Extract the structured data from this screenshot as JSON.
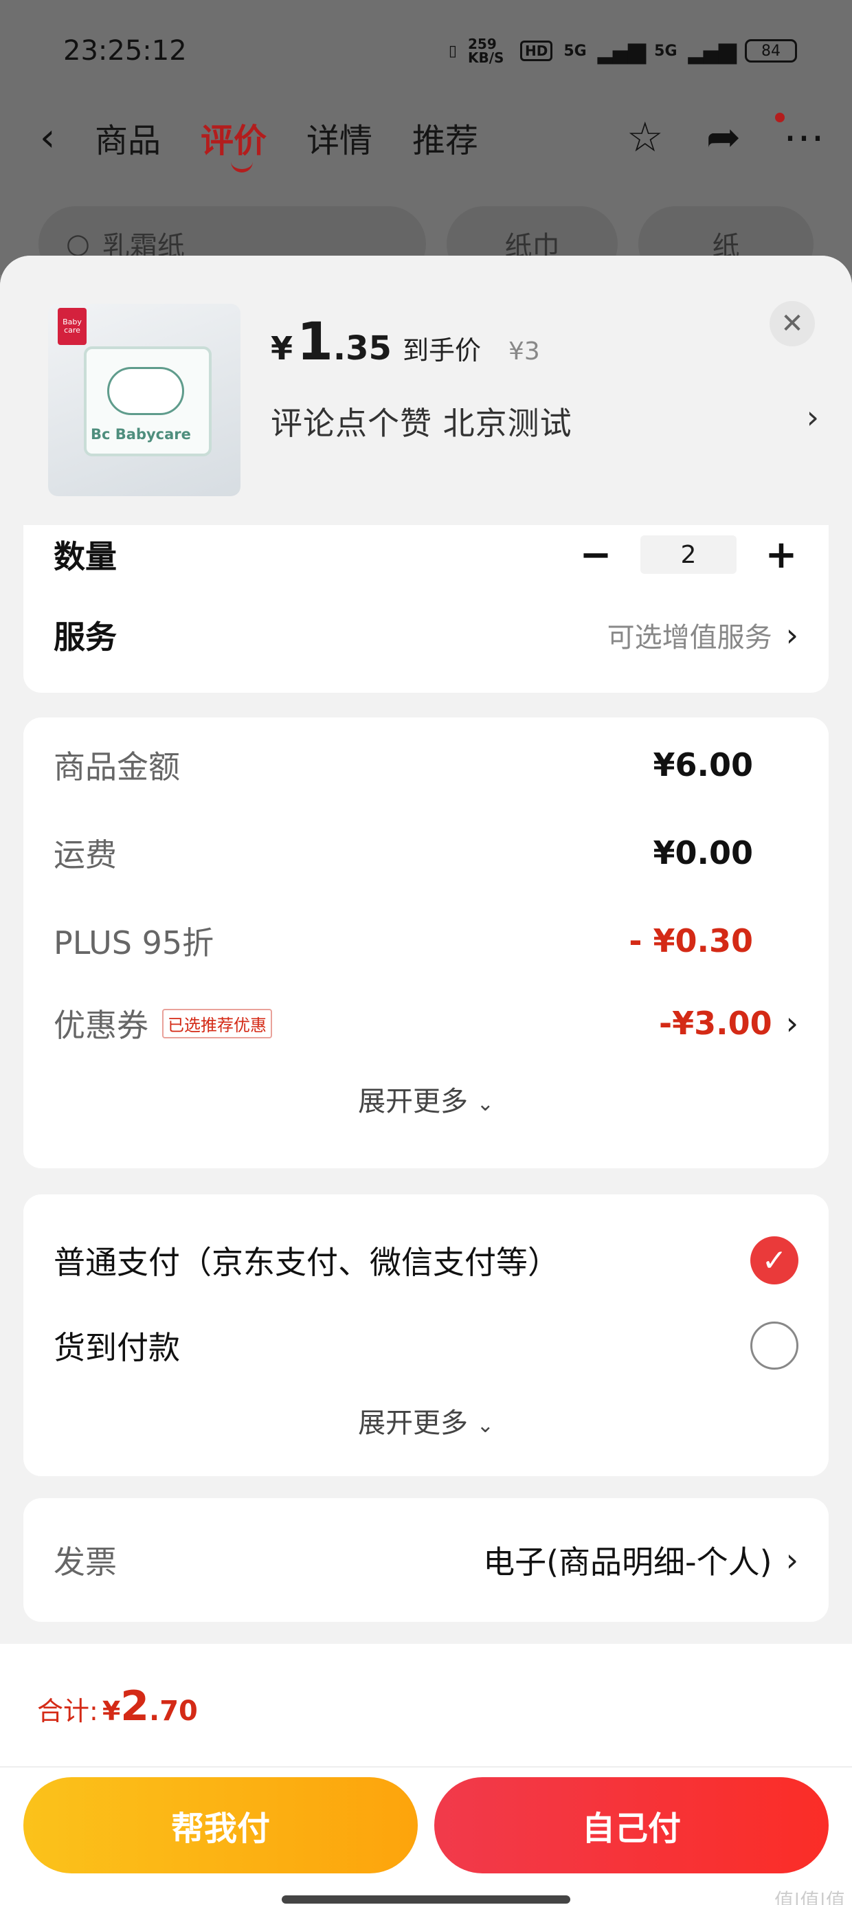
{
  "status_bar": {
    "time": "23:25:12",
    "net_speed": "259 KB/S",
    "hd": "HD",
    "sig1": "5G",
    "sig2": "5G",
    "battery": "84"
  },
  "nav": {
    "tabs": [
      "商品",
      "评价",
      "详情",
      "推荐"
    ],
    "active_tab": "评价"
  },
  "background_chips": {
    "search_text": "乳霜纸",
    "chip2": "纸巾",
    "chip3": "纸"
  },
  "product": {
    "brand_badge": "Baby care",
    "pack_label": "Bc Babycare",
    "price_symbol": "¥",
    "price_int": "1",
    "price_dec": ".35",
    "price_label": "到手价",
    "original_price": "¥3",
    "promo_text": "评论点个赞  北京测试"
  },
  "quantity_row": {
    "label": "数量",
    "value": "2",
    "minus": "−",
    "plus": "+"
  },
  "service_row": {
    "label": "服务",
    "value": "可选增值服务"
  },
  "amounts": {
    "goods_label": "商品金额",
    "goods_value": "¥6.00",
    "shipping_label": "运费",
    "shipping_value": "¥0.00",
    "plus_label": "PLUS 95折",
    "plus_value": "- ¥0.30",
    "coupon_label": "优惠券",
    "coupon_tag": "已选推荐优惠",
    "coupon_value": "-¥3.00",
    "more": "展开更多"
  },
  "payment": {
    "option1": "普通支付（京东支付、微信支付等）",
    "option2": "货到付款",
    "more": "展开更多"
  },
  "invoice": {
    "label": "发票",
    "value": "电子(商品明细-个人)"
  },
  "footer": {
    "total_label": "合计:",
    "total_yen": "¥",
    "total_int": "2",
    "total_dec": ".70",
    "help_pay": "帮我付",
    "self_pay": "自己付",
    "watermark": "值|值|值"
  },
  "colors": {
    "accent_red": "#d42a16",
    "pay_yellow": "#fbc21b",
    "pay_red": "#f13a4b"
  }
}
